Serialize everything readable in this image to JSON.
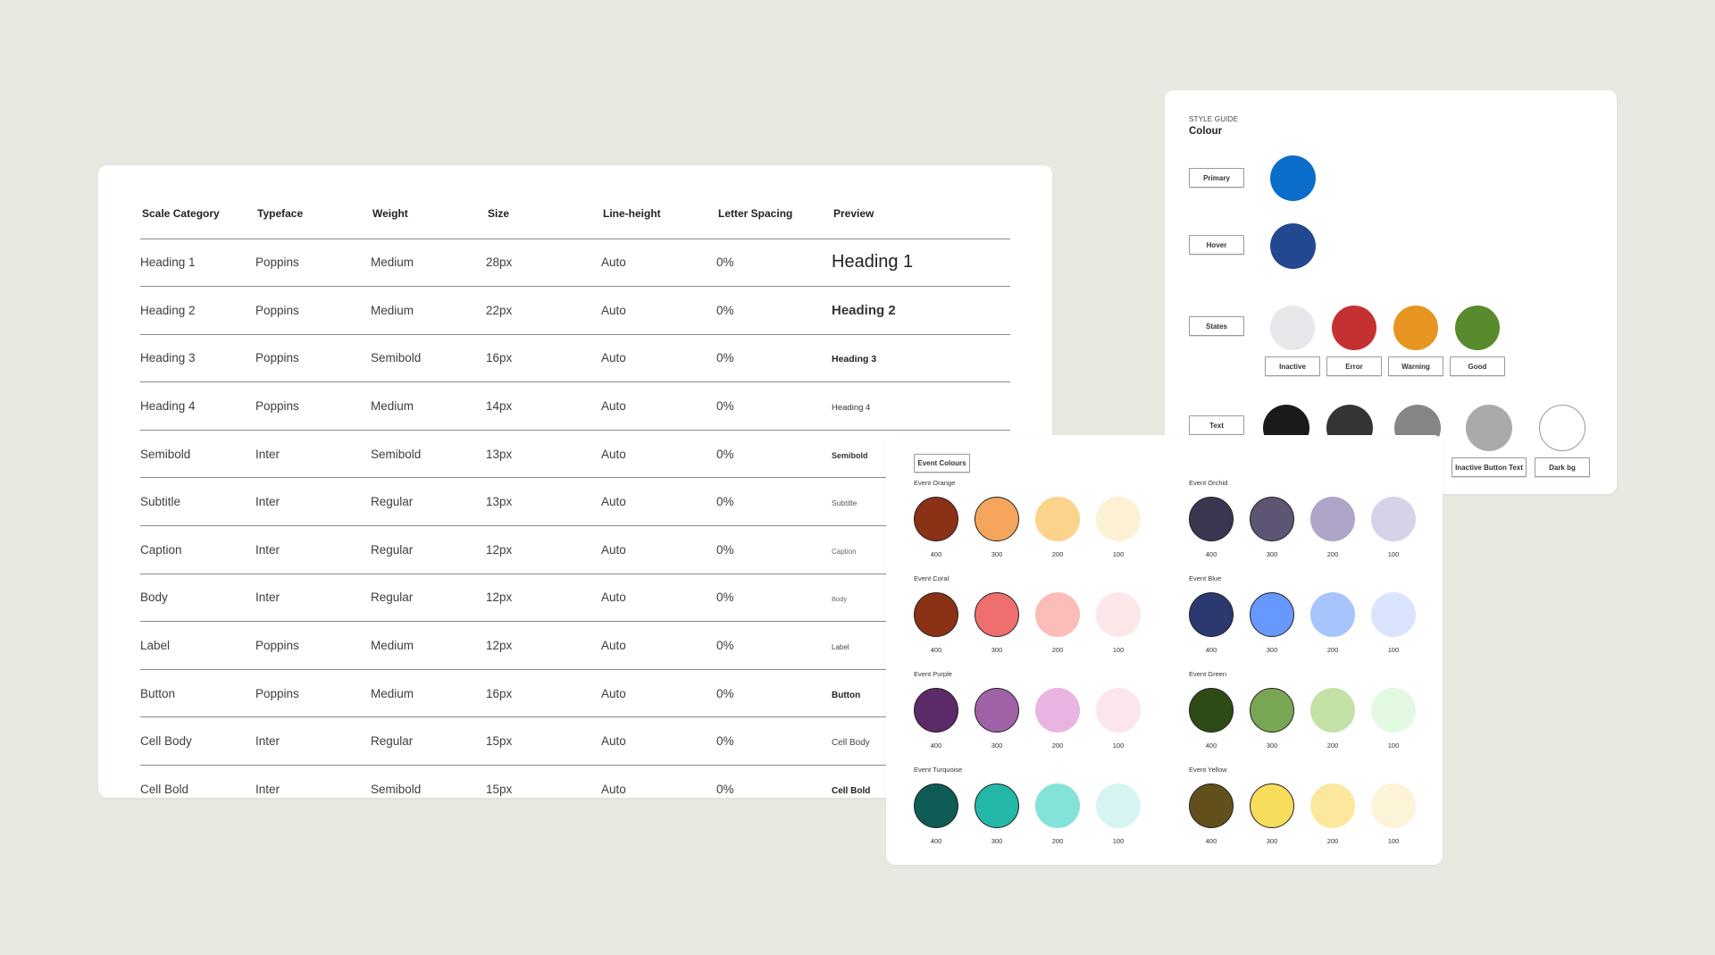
{
  "typography": {
    "headers": [
      "Scale Category",
      "Typeface",
      "Weight",
      "Size",
      "Line-height",
      "Letter Spacing",
      "Preview"
    ],
    "rows": [
      {
        "category": "Heading 1",
        "typeface": "Poppins",
        "weight": "Medium",
        "size": "28px",
        "line_height": "Auto",
        "letter_spacing": "0%",
        "preview": "Heading 1"
      },
      {
        "category": "Heading 2",
        "typeface": "Poppins",
        "weight": "Medium",
        "size": "22px",
        "line_height": "Auto",
        "letter_spacing": "0%",
        "preview": "Heading 2"
      },
      {
        "category": "Heading 3",
        "typeface": "Poppins",
        "weight": "Semibold",
        "size": "16px",
        "line_height": "Auto",
        "letter_spacing": "0%",
        "preview": "Heading 3"
      },
      {
        "category": "Heading 4",
        "typeface": "Poppins",
        "weight": "Medium",
        "size": "14px",
        "line_height": "Auto",
        "letter_spacing": "0%",
        "preview": "Heading 4"
      },
      {
        "category": "Semibold",
        "typeface": "Inter",
        "weight": "Semibold",
        "size": "13px",
        "line_height": "Auto",
        "letter_spacing": "0%",
        "preview": "Semibold"
      },
      {
        "category": "Subtitle",
        "typeface": "Inter",
        "weight": "Regular",
        "size": "13px",
        "line_height": "Auto",
        "letter_spacing": "0%",
        "preview": "Subtitle"
      },
      {
        "category": "Caption",
        "typeface": "Inter",
        "weight": "Regular",
        "size": "12px",
        "line_height": "Auto",
        "letter_spacing": "0%",
        "preview": "Caption"
      },
      {
        "category": "Body",
        "typeface": "Inter",
        "weight": "Regular",
        "size": "12px",
        "line_height": "Auto",
        "letter_spacing": "0%",
        "preview": "Body"
      },
      {
        "category": "Label",
        "typeface": "Poppins",
        "weight": "Medium",
        "size": "12px",
        "line_height": "Auto",
        "letter_spacing": "0%",
        "preview": "Label"
      },
      {
        "category": "Button",
        "typeface": "Poppins",
        "weight": "Medium",
        "size": "16px",
        "line_height": "Auto",
        "letter_spacing": "0%",
        "preview": "Button"
      },
      {
        "category": "Cell Body",
        "typeface": "Inter",
        "weight": "Regular",
        "size": "15px",
        "line_height": "Auto",
        "letter_spacing": "0%",
        "preview": "Cell Body"
      },
      {
        "category": "Cell Bold",
        "typeface": "Inter",
        "weight": "Semibold",
        "size": "15px",
        "line_height": "Auto",
        "letter_spacing": "0%",
        "preview": "Cell Bold"
      }
    ]
  },
  "style_guide": {
    "eyebrow": "STYLE GUIDE",
    "title": "Colour",
    "primary": {
      "label": "Primary",
      "color": "#0a6dc9"
    },
    "hover": {
      "label": "Hover",
      "color": "#22498f"
    },
    "states": {
      "label": "States",
      "swatches": [
        {
          "name": "Inactive",
          "color": "#e8e8ec"
        },
        {
          "name": "Error",
          "color": "#c53131"
        },
        {
          "name": "Warning",
          "color": "#e69520"
        },
        {
          "name": "Good",
          "color": "#5a8a2e"
        }
      ]
    },
    "text": {
      "label": "Text",
      "swatches": [
        {
          "name": "",
          "color": "#1a1a1a"
        },
        {
          "name": "",
          "color": "#343434"
        },
        {
          "name": "",
          "color": "#858585"
        },
        {
          "name": "Inactive Button Text",
          "color": "#aaaaaa"
        },
        {
          "name": "Dark bg",
          "color": "#ffffff"
        }
      ]
    }
  },
  "event_colours": {
    "title": "Event Colours",
    "groups": [
      {
        "name": "Event Orange",
        "swatches": [
          {
            "shade": "400",
            "color": "#8a3116"
          },
          {
            "shade": "300",
            "color": "#f5a65c"
          },
          {
            "shade": "200",
            "color": "#fbd38b"
          },
          {
            "shade": "100",
            "color": "#fdf1d4"
          }
        ]
      },
      {
        "name": "Event Orchid",
        "swatches": [
          {
            "shade": "400",
            "color": "#3b3650"
          },
          {
            "shade": "300",
            "color": "#5e5573"
          },
          {
            "shade": "200",
            "color": "#aea5c8"
          },
          {
            "shade": "100",
            "color": "#d8d1ea"
          }
        ]
      },
      {
        "name": "Event Coral",
        "swatches": [
          {
            "shade": "400",
            "color": "#8a3116"
          },
          {
            "shade": "300",
            "color": "#ef6e6e"
          },
          {
            "shade": "200",
            "color": "#fcbcb8"
          },
          {
            "shade": "100",
            "color": "#fde6e8"
          }
        ]
      },
      {
        "name": "Event Blue",
        "swatches": [
          {
            "shade": "400",
            "color": "#2b396f"
          },
          {
            "shade": "300",
            "color": "#6798fb"
          },
          {
            "shade": "200",
            "color": "#a8c4fc"
          },
          {
            "shade": "100",
            "color": "#dae5fd"
          }
        ]
      },
      {
        "name": "Event Purple",
        "swatches": [
          {
            "shade": "400",
            "color": "#5c2a68"
          },
          {
            "shade": "300",
            "color": "#a062a6"
          },
          {
            "shade": "200",
            "color": "#eab4e0"
          },
          {
            "shade": "100",
            "color": "#fce5ef"
          }
        ]
      },
      {
        "name": "Event Green",
        "swatches": [
          {
            "shade": "400",
            "color": "#2e4b16"
          },
          {
            "shade": "300",
            "color": "#79a653"
          },
          {
            "shade": "200",
            "color": "#c4e1a6"
          },
          {
            "shade": "100",
            "color": "#e3f9e2"
          }
        ]
      },
      {
        "name": "Event Turquoise",
        "swatches": [
          {
            "shade": "400",
            "color": "#0e5c55"
          },
          {
            "shade": "300",
            "color": "#22b7a6"
          },
          {
            "shade": "200",
            "color": "#84e3d9"
          },
          {
            "shade": "100",
            "color": "#d6f5f2"
          }
        ]
      },
      {
        "name": "Event Yellow",
        "swatches": [
          {
            "shade": "400",
            "color": "#61501c"
          },
          {
            "shade": "300",
            "color": "#f8dc5c"
          },
          {
            "shade": "200",
            "color": "#fbe89c"
          },
          {
            "shade": "100",
            "color": "#fdf3d6"
          }
        ]
      }
    ]
  }
}
